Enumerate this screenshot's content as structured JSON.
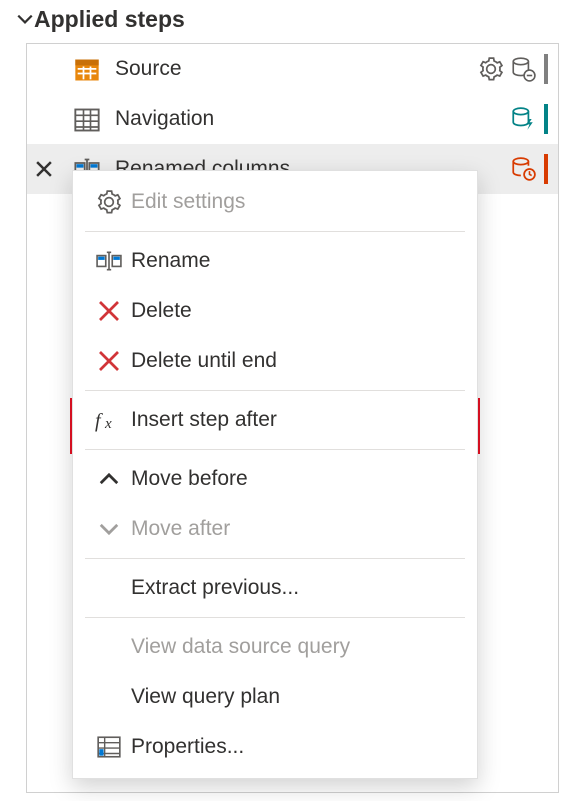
{
  "panel": {
    "title": "Applied steps"
  },
  "steps": [
    {
      "name": "Source",
      "accent": "#808080"
    },
    {
      "name": "Navigation",
      "accent": "#038387"
    },
    {
      "name": "Renamed columns",
      "accent": "#d83b01"
    }
  ],
  "contextMenu": {
    "editSettings": "Edit settings",
    "rename": "Rename",
    "delete": "Delete",
    "deleteUntilEnd": "Delete until end",
    "insertStepAfter": "Insert step after",
    "moveBefore": "Move before",
    "moveAfter": "Move after",
    "extractPrevious": "Extract previous...",
    "viewDataSourceQuery": "View data source query",
    "viewQueryPlan": "View query plan",
    "properties": "Properties..."
  },
  "colors": {
    "iconGray": "#605e5c",
    "iconOrange": "#e8870c",
    "deleteRed": "#d13438",
    "disabledGray": "#a19f9d"
  }
}
